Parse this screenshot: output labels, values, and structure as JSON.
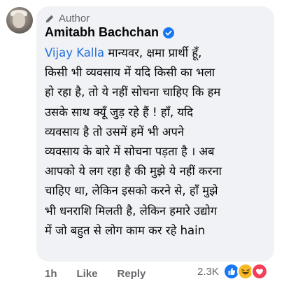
{
  "post": {
    "author_badge": "Author",
    "author_name": "Amitabh Bachchan",
    "mention": "Vijay Kalla",
    "lines": [
      " मान्यवर, क्षमा प्रार्थी हूँ,",
      "किसी भी व्यवसाय में यदि किसी का भला",
      "हो रहा है, तो ये नहीं सोचना चाहिए कि हम",
      "उसके साथ क्यूँ जुड़ रहे हैं  ! हाँ, यदि",
      "व्यवसाय है तो उसमें  हमें भी अपने",
      "व्यवसाय के बारे में सोचना पड़ता है  । अब",
      "आपको ये लग रहा है की मुझे ये नहीं करना",
      "चाहिए था, लेकिन इसको करने से, हाँ मुझे",
      "भी धनराशि मिलती है, लेकिन हमारे उद्योग",
      "में जो बहुत  से लोग काम कर रहे hain"
    ]
  },
  "actions": {
    "time": "1h",
    "like": "Like",
    "reply": "Reply"
  },
  "reactions": {
    "count": "2.3K",
    "icons": [
      "like-icon",
      "haha-icon",
      "love-icon"
    ]
  },
  "colors": {
    "bubble": "#f0f2f5",
    "mention": "#216fdb",
    "verified": "#1877f2",
    "muted": "#65676b"
  }
}
